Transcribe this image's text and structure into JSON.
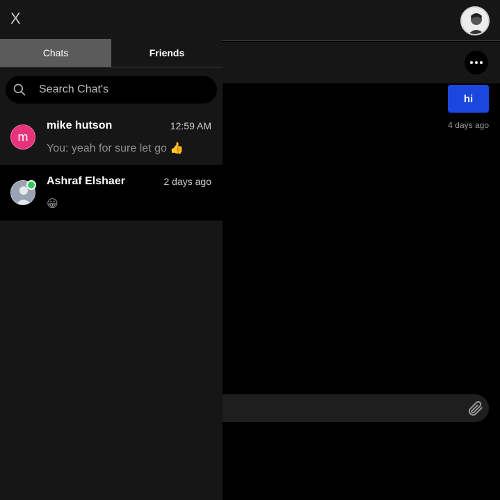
{
  "header": {
    "close_label": "X"
  },
  "tabs": [
    {
      "label": "Chats",
      "active": true
    },
    {
      "label": "Friends",
      "active": false
    }
  ],
  "search": {
    "placeholder": "Search Chat's"
  },
  "conversations": [
    {
      "name": "mike hutson",
      "initial": "m",
      "time": "12:59 AM",
      "preview": "You: yeah for sure let go 👍",
      "online": false
    },
    {
      "name": "Ashraf Elshaer",
      "time": "2 days ago",
      "preview": "😀",
      "online": true
    }
  ],
  "messages": [
    {
      "text": "hi",
      "time": "4 days ago",
      "sent": true
    }
  ],
  "colors": {
    "accent": "#1a47e0",
    "online": "#2fc85a",
    "avatar_pink": "#e7337a"
  },
  "icons": [
    "close-icon",
    "search-icon",
    "more-options-icon",
    "paperclip-icon"
  ]
}
